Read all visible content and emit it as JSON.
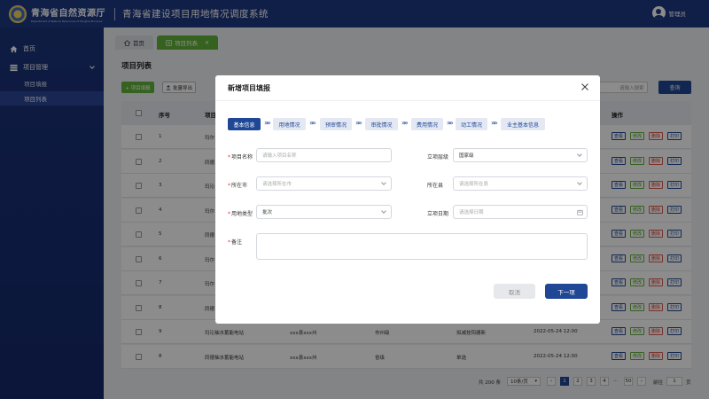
{
  "header": {
    "org_name": "青海省自然资源厅",
    "org_en": "Department of Natural Resources of Qinghai Province",
    "system_title": "青海省建设项目用地情况调度系统",
    "user_name": "管理员"
  },
  "sidebar": {
    "home": "首页",
    "project_mgmt": "项目管理",
    "sub_items": [
      "项目填报",
      "项目列表"
    ]
  },
  "tabs": {
    "home": "首页",
    "active": "项目列表",
    "close": "✕"
  },
  "page": {
    "title": "项目列表",
    "add_label": "+ 项目填报",
    "export_label": "批量导出",
    "search_placeholder": "请输入搜索",
    "search_label": "查询"
  },
  "table": {
    "headers": {
      "no": "序号",
      "name": "项目",
      "actions": "操作"
    },
    "action_labels": {
      "view": "查看",
      "edit": "修改",
      "del": "删除",
      "print": "打印"
    },
    "rows": [
      {
        "no": "1",
        "name": "玛尔",
        "loc": "",
        "level": "",
        "type": "",
        "date": ""
      },
      {
        "no": "2",
        "name": "同德",
        "loc": "",
        "level": "",
        "type": "",
        "date": ""
      },
      {
        "no": "3",
        "name": "玛沁",
        "loc": "",
        "level": "",
        "type": "",
        "date": ""
      },
      {
        "no": "4",
        "name": "玛尔",
        "loc": "",
        "level": "",
        "type": "",
        "date": ""
      },
      {
        "no": "5",
        "name": "同德",
        "loc": "",
        "level": "",
        "type": "",
        "date": ""
      },
      {
        "no": "6",
        "name": "玛尔",
        "loc": "",
        "level": "",
        "type": "",
        "date": ""
      },
      {
        "no": "7",
        "name": "玛尔",
        "loc": "",
        "level": "",
        "type": "",
        "date": ""
      },
      {
        "no": "8",
        "name": "同德",
        "loc": "",
        "level": "",
        "type": "",
        "date": ""
      },
      {
        "no": "9",
        "name": "玛沁抽水蓄能电站",
        "loc": "xxx县xxx州",
        "level": "市州级",
        "type": "拟减挂钩建新",
        "date": "2022-05-24 12:00"
      },
      {
        "no": "8",
        "name": "同德抽水蓄能电站",
        "loc": "xxx县xxx州",
        "level": "省级",
        "type": "单选",
        "date": "2022-05-24 12:00"
      }
    ]
  },
  "pagination": {
    "total": "共 200 条",
    "page_size": "10条/页",
    "prev": "‹",
    "pages": [
      "1",
      "2",
      "3",
      "4"
    ],
    "ellipsis": "···",
    "last": "50",
    "next": "›",
    "goto_label": "前往",
    "goto_value": "1",
    "page_suffix": "页"
  },
  "modal": {
    "title": "新增项目填报",
    "steps": [
      "基本信息",
      "用地情况",
      "预审情况",
      "审批情况",
      "费用情况",
      "动工情况",
      "业主基本信息"
    ],
    "step_arrow": "»»",
    "req_mark": "*",
    "fields": {
      "project_name": {
        "label": "项目名称",
        "placeholder": "请输入项目名称"
      },
      "approval_level": {
        "label": "立项层级",
        "value": "国家级"
      },
      "city": {
        "label": "所在市",
        "placeholder": "请选择所在市"
      },
      "county": {
        "label": "所在县",
        "placeholder": "请选择所在县"
      },
      "land_type": {
        "label": "用地类型",
        "value": "批次"
      },
      "approval_date": {
        "label": "立项日期",
        "placeholder": "请选择日期"
      },
      "remarks": {
        "label": "备注"
      }
    },
    "cancel_label": "取消",
    "next_label": "下一项"
  }
}
